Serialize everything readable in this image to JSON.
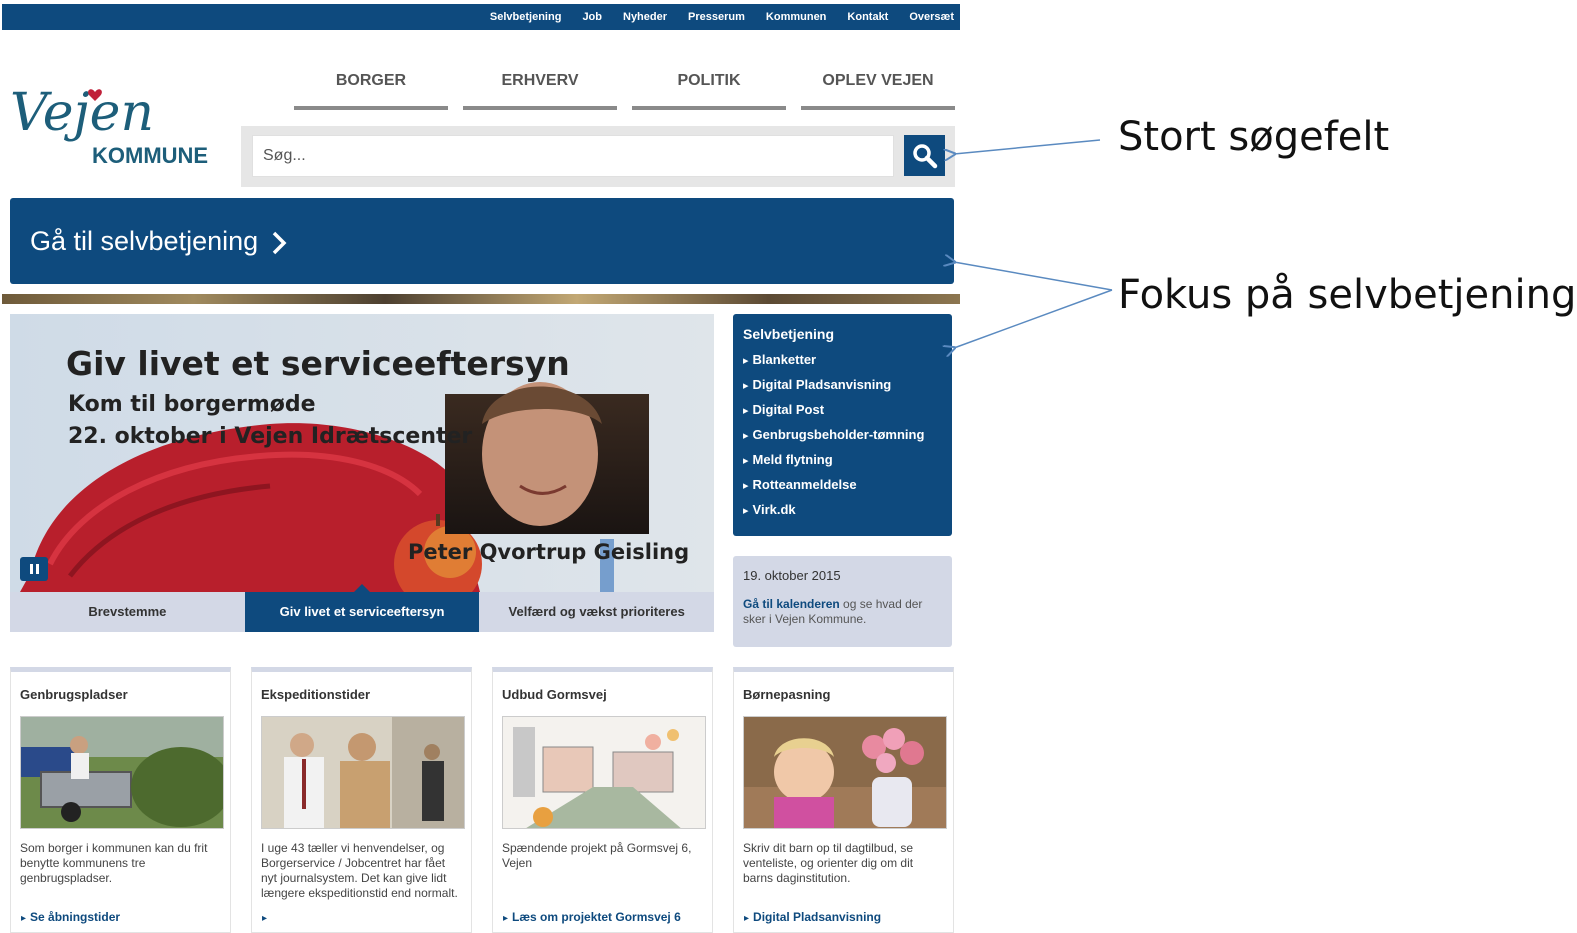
{
  "top_links": [
    "Selvbetjening",
    "Job",
    "Nyheder",
    "Presserum",
    "Kommunen",
    "Kontakt",
    "Oversæt"
  ],
  "logo": {
    "name": "Vejen",
    "sub": "KOMMUNE"
  },
  "main_nav": [
    "BORGER",
    "ERHVERV",
    "POLITIK",
    "OPLEV VEJEN"
  ],
  "search": {
    "placeholder": "Søg..."
  },
  "self_banner": {
    "label": "Gå til selvbetjening"
  },
  "slideshow": {
    "title": "Giv livet et serviceeftersyn",
    "subtitle": "Kom til borgermøde",
    "date_line": "22. oktober i Vejen Idrætscenter",
    "caption": "Peter Qvortrup Geisling",
    "tabs": [
      "Brevstemme",
      "Giv livet et serviceeftersyn",
      "Velfærd og vækst prioriteres"
    ],
    "active_tab": 1
  },
  "selfservice_box": {
    "title": "Selvbetjening",
    "items": [
      "Blanketter",
      "Digital Pladsanvisning",
      "Digital Post",
      "Genbrugsbeholder-tømning",
      "Meld flytning",
      "Rotteanmeldelse",
      "Virk.dk"
    ]
  },
  "calendar": {
    "date": "19. oktober 2015",
    "link": "Gå til kalenderen",
    "text": " og se hvad der sker i Vejen Kommune."
  },
  "cards": [
    {
      "title": "Genbrugspladser",
      "text": "Som borger i kommunen kan du frit benytte kommunens tre genbrugspladser.",
      "link": "Se åbningstider",
      "image_icon": "trailer-photo"
    },
    {
      "title": "Ekspeditionstider",
      "text": "I uge 43 tæller vi henvendelser, og Borgerservice / Jobcentret har fået nyt journalsystem. Det kan give lidt længere ekspeditionstid end normalt.",
      "link": "",
      "image_icon": "office-photo"
    },
    {
      "title": "Udbud Gormsvej",
      "text": "Spændende projekt på Gormsvej 6, Vejen",
      "link": "Læs om projektet Gormsvej 6",
      "image_icon": "architecture-sketch"
    },
    {
      "title": "Børnepasning",
      "text": "Skriv dit barn op til dagtilbud, se venteliste, og orienter dig om dit barns daginstitution.",
      "link": "Digital Pladsanvisning",
      "image_icon": "child-flowers-photo"
    }
  ],
  "annotations": {
    "search": "Stort søgefelt",
    "selfservice": "Fokus på selvbetjening"
  },
  "colors": {
    "brand_blue": "#0e4a7e",
    "light_panel": "#d3d8e6",
    "logo_teal": "#1d5e7a",
    "heart_red": "#c0213a"
  }
}
